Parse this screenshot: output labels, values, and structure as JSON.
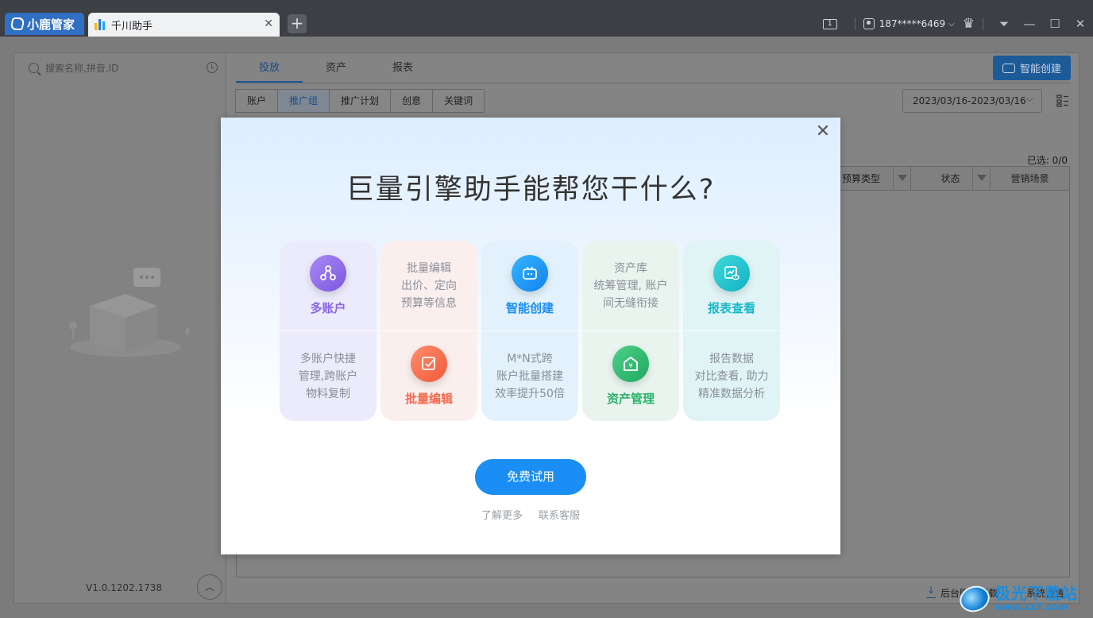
{
  "titlebar": {
    "brand": "小鹿管家",
    "tab_title": "千川助手",
    "tab_close": "✕",
    "new_tab": "+",
    "notification_count": "1",
    "user": "187*****6469",
    "user_chevron": "⌵",
    "window_controls": {
      "menu": "⏷",
      "minimize": "—",
      "maximize": "☐",
      "close": "✕"
    }
  },
  "sidebar": {
    "search_placeholder": "搜索名称,拼音,ID",
    "version": "V1.0.1202.1738",
    "collapse": "︿"
  },
  "main": {
    "tabs": [
      {
        "label": "投放",
        "active": true
      },
      {
        "label": "资产",
        "active": false
      },
      {
        "label": "报表",
        "active": false
      }
    ],
    "ai_create_label": "智能创建",
    "sub_tabs": [
      {
        "label": "账户",
        "active": false
      },
      {
        "label": "推广组",
        "active": true
      },
      {
        "label": "推广计划",
        "active": false
      },
      {
        "label": "创意",
        "active": false
      },
      {
        "label": "关键词",
        "active": false
      }
    ],
    "date_range": "2023/03/16-2023/03/16",
    "selected_count": "已选: 0/0",
    "table_headers": [
      "预算类型",
      "状态",
      "营销场景"
    ],
    "bottom_actions": {
      "download": "后台账户下载",
      "settings": "系统设置"
    }
  },
  "modal": {
    "close": "✕",
    "title": "巨量引擎助手能帮您干什么?",
    "features": [
      {
        "top_label": "多账户",
        "top_icon": "multi-account-icon",
        "bottom_desc": [
          "多账户快捷",
          "管理,跨账户",
          "物料复制"
        ],
        "color": "#8b67e8",
        "icon_bg": "linear-gradient(135deg,#a98af5,#7b57e0)"
      },
      {
        "top_desc": [
          "批量编辑",
          "出价、定向",
          "预算等信息"
        ],
        "bottom_label": "批量编辑",
        "bottom_icon": "batch-edit-icon",
        "color": "#f46a4e",
        "icon_bg": "linear-gradient(135deg,#ff8c6b,#f05a3c)"
      },
      {
        "top_label": "智能创建",
        "top_icon": "robot-icon",
        "bottom_desc": [
          "M*N式跨",
          "账户批量搭建",
          "效率提升50倍"
        ],
        "color": "#1a8ef5",
        "icon_bg": "linear-gradient(135deg,#36b3ff,#1384ee)"
      },
      {
        "top_desc": [
          "资产库",
          "统筹管理, 账户",
          "间无缝衔接"
        ],
        "bottom_label": "资产管理",
        "bottom_icon": "asset-home-icon",
        "color": "#29b46a",
        "icon_bg": "linear-gradient(135deg,#4fd08a,#20a85e)"
      },
      {
        "top_label": "报表查看",
        "top_icon": "report-view-icon",
        "bottom_desc": [
          "报告数据",
          "对比查看, 助力",
          "精准数据分析"
        ],
        "color": "#19b9c8",
        "icon_bg": "linear-gradient(135deg,#3fd9d8,#14b1c7)"
      }
    ],
    "cta": "免费试用",
    "links": [
      "了解更多",
      "联系客服"
    ]
  },
  "watermark": {
    "title": "极光下载站",
    "url": "www.xz7.com"
  }
}
